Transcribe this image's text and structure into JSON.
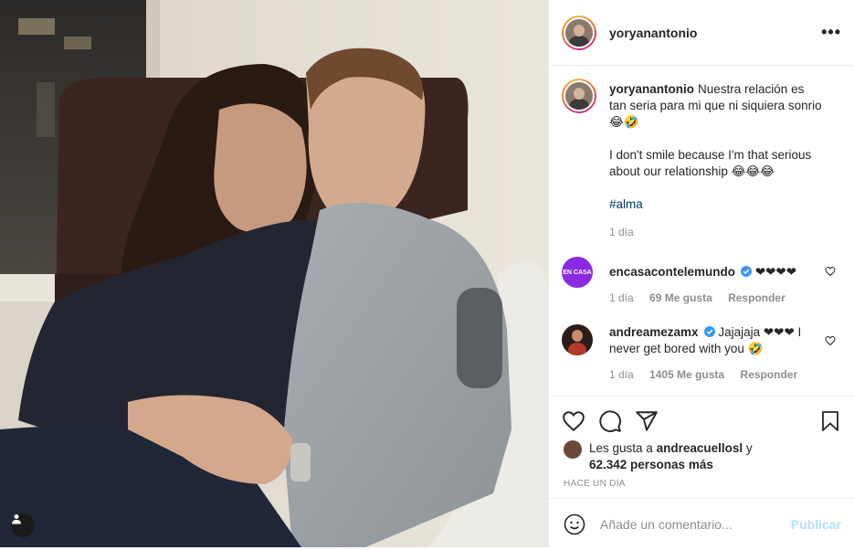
{
  "post": {
    "username": "yoryanantonio",
    "more_icon": "more-horizontal-icon",
    "caption": {
      "user": "yoryanantonio",
      "line1": "Nuestra relación es tan seria para mi que ni siquiera sonrio ",
      "line1_emoji": "😂🤣",
      "line2": "I don't smile because I'm that serious about our relationship ",
      "line2_emoji": "😂😂😂",
      "hashtag": "#alma",
      "time": "1 día"
    },
    "comments": [
      {
        "user": "encasacontelemundo",
        "verified": true,
        "text": "❤❤❤❤",
        "time": "1 día",
        "likes": "69 Me gusta",
        "reply": "Responder",
        "avatar_color": "#8a2be2",
        "avatar_text": "EN CASA"
      },
      {
        "user": "andreamezamx",
        "verified": true,
        "text": "Jajajaja ❤❤❤ I never get bored with you ",
        "emoji": "🤣",
        "time": "1 día",
        "likes": "1405 Me gusta",
        "reply": "Responder",
        "avatar_color": "#2b1d17"
      }
    ],
    "likes": {
      "prefix": "Les gusta a ",
      "user": "andreacuellosl",
      "mid": " y ",
      "count": "62.342 personas más"
    },
    "timestamp": "HACE UN DÍA",
    "add_comment": {
      "placeholder": "Añade un comentario...",
      "publish": "Publicar"
    },
    "colors": {
      "accent_blue": "#0095f6",
      "disabled_blue": "#b2dffc",
      "muted": "#8e8e8e",
      "verified": "#3897f0"
    }
  }
}
